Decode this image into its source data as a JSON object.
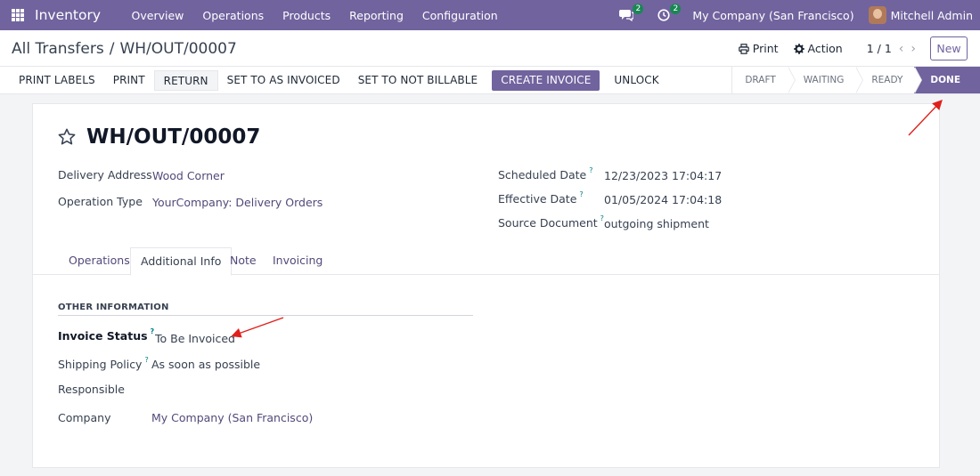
{
  "navbar": {
    "app_name": "Inventory",
    "menu": [
      "Overview",
      "Operations",
      "Products",
      "Reporting",
      "Configuration"
    ],
    "messages_count": "2",
    "activities_count": "2",
    "company": "My Company (San Francisco)",
    "user": "Mitchell Admin"
  },
  "control": {
    "breadcrumb_parent": "All Transfers",
    "breadcrumb_separator": "/",
    "breadcrumb_current": "WH/OUT/00007",
    "print_label": "Print",
    "action_label": "Action",
    "pager": "1 / 1",
    "new_label": "New"
  },
  "statusbar": {
    "buttons": [
      "PRINT LABELS",
      "PRINT",
      "RETURN",
      "SET TO AS INVOICED",
      "SET TO NOT BILLABLE",
      "CREATE INVOICE",
      "UNLOCK"
    ],
    "stages": [
      "DRAFT",
      "WAITING",
      "READY",
      "DONE"
    ],
    "active_stage": "DONE"
  },
  "record": {
    "title": "WH/OUT/00007",
    "delivery_address_label": "Delivery Address",
    "delivery_address": "Wood Corner",
    "operation_type_label": "Operation Type",
    "operation_type": "YourCompany: Delivery Orders",
    "scheduled_date_label": "Scheduled Date",
    "scheduled_date": "12/23/2023 17:04:17",
    "effective_date_label": "Effective Date",
    "effective_date": "01/05/2024 17:04:18",
    "source_document_label": "Source Document",
    "source_document": "outgoing shipment",
    "help_mark": "?"
  },
  "tabs": [
    "Operations",
    "Additional Info",
    "Note",
    "Invoicing"
  ],
  "active_tab": "Additional Info",
  "other_info": {
    "section_title": "OTHER INFORMATION",
    "invoice_status_label": "Invoice Status",
    "invoice_status": "To Be Invoiced",
    "shipping_policy_label": "Shipping Policy",
    "shipping_policy": "As soon as possible",
    "responsible_label": "Responsible",
    "company_label": "Company",
    "company": "My Company (San Francisco)"
  },
  "colors": {
    "brand": "#71639e",
    "link": "#53497a",
    "badge": "#198754",
    "help": "#017e84",
    "annotation_arrow": "#e0201b"
  },
  "icons": [
    "apps-grid-icon",
    "chat-icon",
    "clock-icon",
    "printer-icon",
    "gear-icon",
    "chevron-left-icon",
    "chevron-right-icon",
    "star-icon"
  ]
}
